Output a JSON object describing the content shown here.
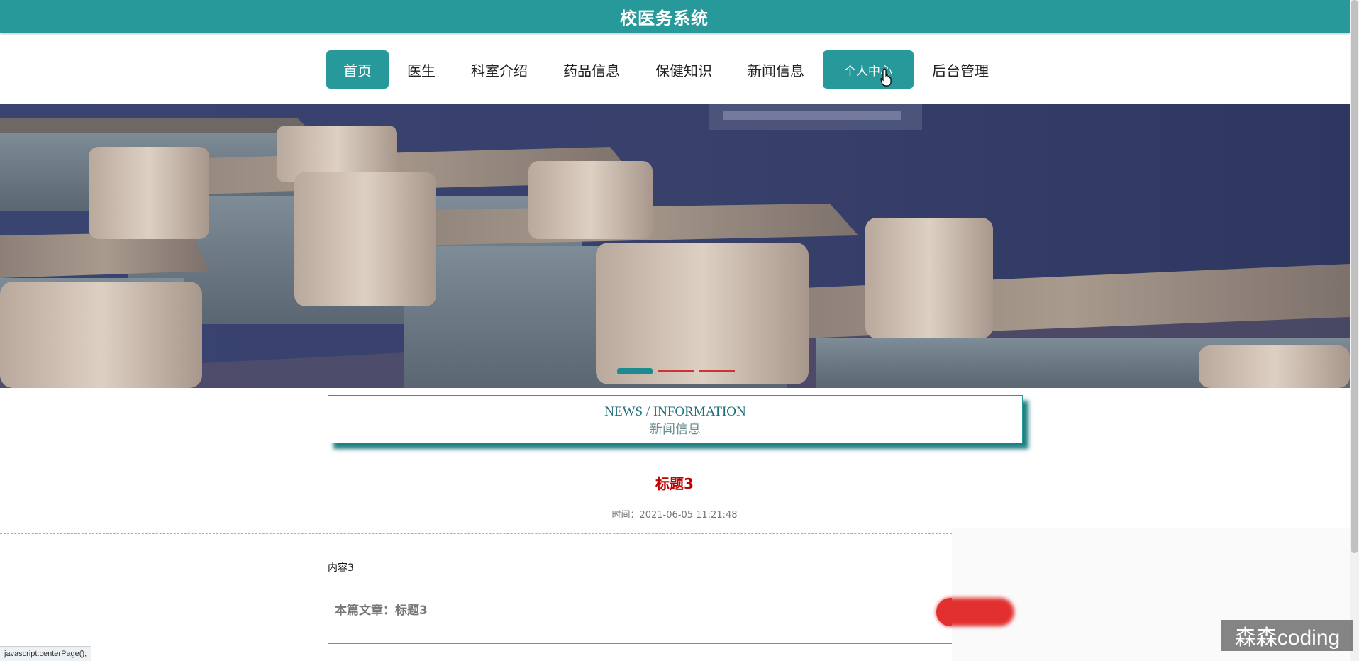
{
  "header": {
    "title": "校医务系统"
  },
  "nav": {
    "items": [
      {
        "label": "首页",
        "state": "active"
      },
      {
        "label": "医生",
        "state": "normal"
      },
      {
        "label": "科室介绍",
        "state": "normal"
      },
      {
        "label": "药品信息",
        "state": "normal"
      },
      {
        "label": "保健知识",
        "state": "normal"
      },
      {
        "label": "新闻信息",
        "state": "normal"
      },
      {
        "label": "个人中心",
        "state": "hover"
      },
      {
        "label": "后台管理",
        "state": "normal"
      }
    ]
  },
  "banner": {
    "slide_count": 3,
    "active_slide": 1
  },
  "section": {
    "title_en": "NEWS / INFORMATION",
    "title_cn": "新闻信息"
  },
  "article": {
    "title": "标题3",
    "time": "时间：2021-06-05 11:21:48",
    "content": "内容3",
    "this_article": "本篇文章：标题3"
  },
  "statusbar": {
    "text": "javascript:centerPage();"
  },
  "watermark": {
    "text": "森森coding"
  },
  "colors": {
    "primary": "#27999b",
    "title_red": "#c00000",
    "back_button": "#e23030"
  },
  "icons": {
    "back": "arrow-left-icon",
    "cursor": "hand-pointer-icon"
  }
}
